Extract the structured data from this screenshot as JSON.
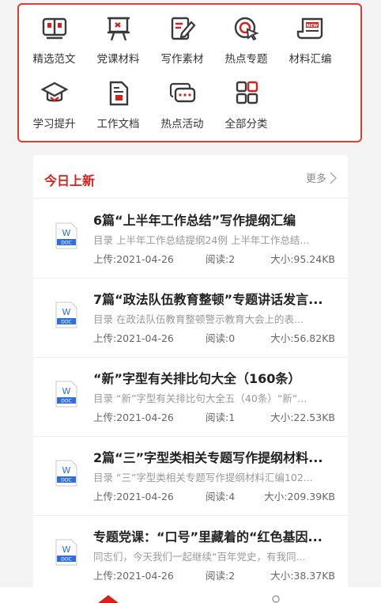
{
  "categories": [
    {
      "label": "精选范文",
      "icon": "book-icon"
    },
    {
      "label": "党课材料",
      "icon": "presentation-board-icon"
    },
    {
      "label": "写作素材",
      "icon": "write-notes-icon"
    },
    {
      "label": "热点专题",
      "icon": "target-cursor-icon"
    },
    {
      "label": "材料汇编",
      "icon": "newspaper-icon"
    },
    {
      "label": "学习提升",
      "icon": "graduation-cap-icon"
    },
    {
      "label": "工作文档",
      "icon": "document-icon"
    },
    {
      "label": "热点活动",
      "icon": "chat-bubble-icon"
    },
    {
      "label": "全部分类",
      "icon": "grid-icon"
    }
  ],
  "news": {
    "title": "今日上新",
    "more_label": "更多",
    "items": [
      {
        "title": "6篇“上半年工作总结”写作提纲汇编",
        "summary": "目录 上半年工作总结提纲24例 上半年工作总结...",
        "upload": "上传:2021-04-26",
        "reads": "阅读:2",
        "size": "大小:95.24KB"
      },
      {
        "title": "7篇“政法队伍教育整顿”专题讲话发言...",
        "summary": "目录 在政法队伍教育整顿警示教育大会上的表...",
        "upload": "上传:2021-04-26",
        "reads": "阅读:0",
        "size": "大小:56.82KB"
      },
      {
        "title": "“新”字型有关排比句大全（160条）",
        "summary": "目录 “新”字型有关排比句大全五（40条）“新”...",
        "upload": "上传:2021-04-26",
        "reads": "阅读:1",
        "size": "大小:22.53KB"
      },
      {
        "title": "2篇“三”字型类相关专题写作提纲材料...",
        "summary": "目录 “三”字型类相关专题写作提纲材料汇编102...",
        "upload": "上传:2021-04-26",
        "reads": "阅读:4",
        "size": "大小:209.39KB"
      },
      {
        "title": "专题党课：“口号”里藏着的“红色基因...",
        "summary": "同志们，今天我们一起继续“百年党史，有我同...",
        "upload": "上传:2021-04-26",
        "reads": "阅读:2",
        "size": "大小:38.37KB"
      }
    ],
    "doc_badge": {
      "letter": "W",
      "label": "DOC"
    }
  },
  "colors": {
    "accent": "#d6201a",
    "border": "#e23b2f",
    "doc_blue": "#2f6fd6"
  }
}
